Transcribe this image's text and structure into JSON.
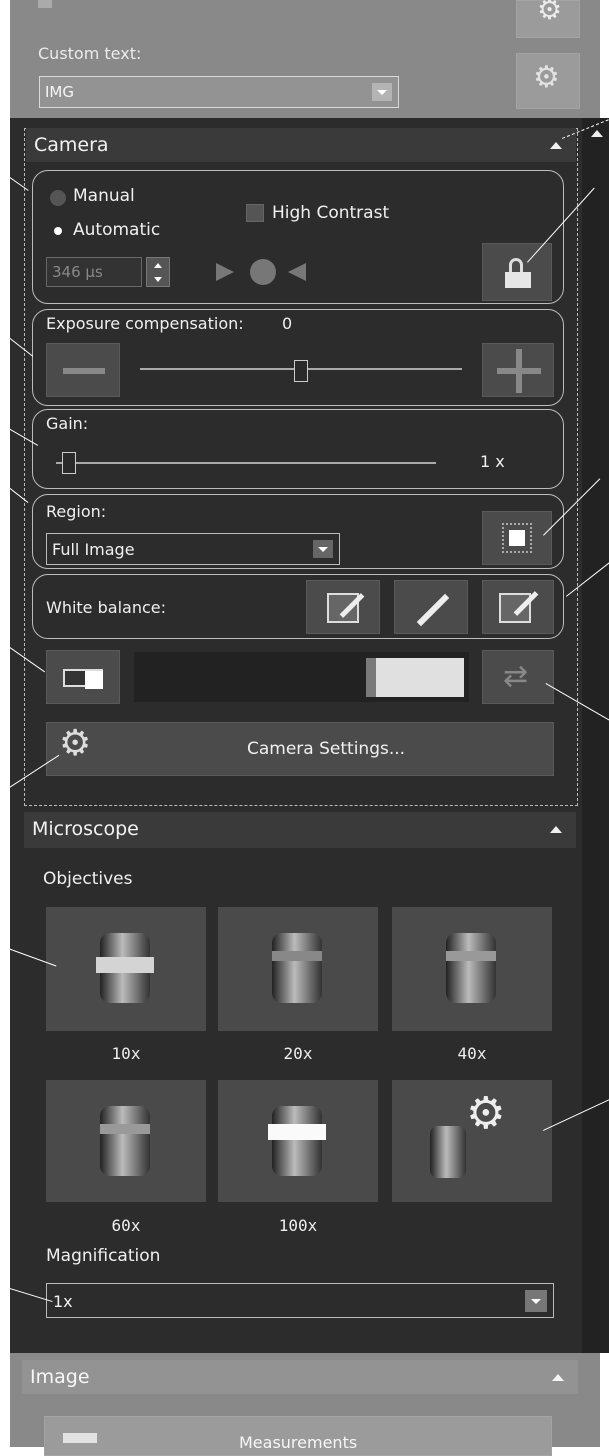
{
  "top_section": {
    "custom_text_label": "Custom text:",
    "custom_text_value": "IMG"
  },
  "camera": {
    "title": "Camera",
    "mode_manual": "Manual",
    "mode_automatic": "Automatic",
    "selected_mode": "Automatic",
    "high_contrast_label": "High Contrast",
    "exposure_time": "346 μs",
    "exposure_compensation_label": "Exposure compensation:",
    "exposure_compensation_value": "0",
    "gain_label": "Gain:",
    "gain_value": "1 x",
    "region_label": "Region:",
    "region_value": "Full Image",
    "white_balance_label": "White balance:",
    "settings_button": "Camera Settings..."
  },
  "microscope": {
    "title": "Microscope",
    "objectives_label": "Objectives",
    "objectives": [
      "10x",
      "20x",
      "40x",
      "60x",
      "100x"
    ],
    "magnification_label": "Magnification",
    "magnification_value": "1x"
  },
  "image": {
    "title": "Image",
    "measurements_button": "Measurements"
  }
}
